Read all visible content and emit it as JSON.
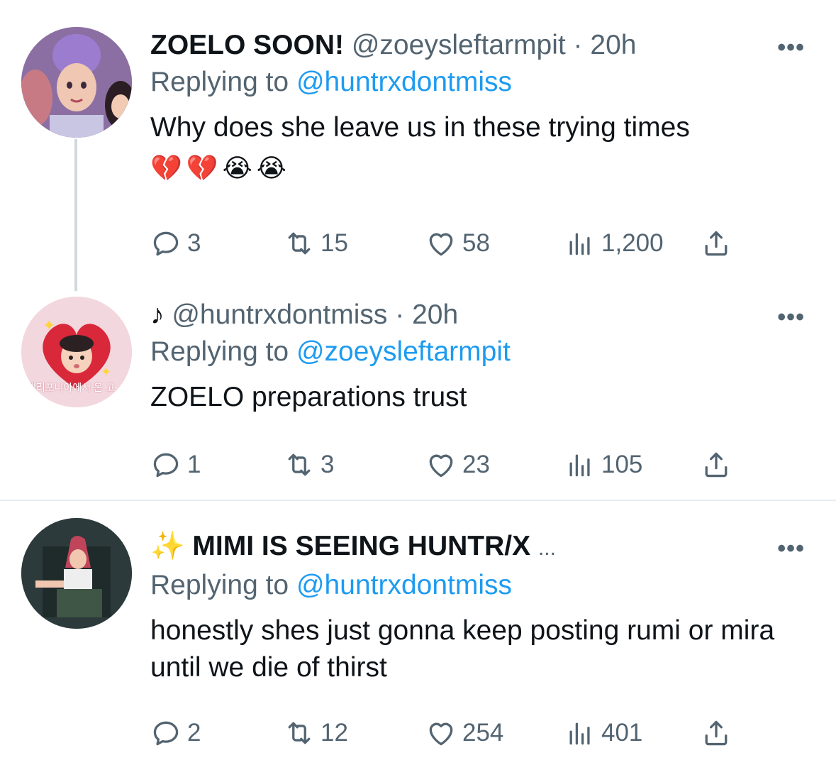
{
  "tweets": [
    {
      "name": "ZOELO SOON!",
      "handle": "@zoeysleftarmpit",
      "sep": "·",
      "time": "20h",
      "replying_prefix": "Replying to",
      "replying_to": "@huntrxdontmiss",
      "text": "Why does she leave us in these trying times",
      "emojis": "💔💔😭😭",
      "replies": "3",
      "retweets": "15",
      "likes": "58",
      "views": "1,200"
    },
    {
      "name": "♪",
      "handle": "@huntrxdontmiss",
      "sep": "·",
      "time": "20h",
      "replying_prefix": "Replying to",
      "replying_to": "@zoeysleftarmpit",
      "text": "ZOELO preparations trust",
      "replies": "1",
      "retweets": "3",
      "likes": "23",
      "views": "105",
      "avatar_text": "캘리포니아에서 온 고"
    },
    {
      "name_emoji": "✨",
      "name": "MIMI IS SEEING HUNTR/X",
      "ellipsis": "...",
      "replying_prefix": "Replying to",
      "replying_to": "@huntrxdontmiss",
      "text": "honestly shes just gonna keep posting rumi or mira until we die of thirst",
      "replies": "2",
      "retweets": "12",
      "likes": "254",
      "views": "401"
    }
  ],
  "more_glyph": "•••",
  "colors": {
    "accent": "#1d9bf0",
    "muted": "#536471",
    "text": "#0f1419",
    "divider": "#e6ecf0"
  },
  "icons": [
    "reply-icon",
    "retweet-icon",
    "like-icon",
    "views-icon",
    "share-icon",
    "more-icon"
  ]
}
